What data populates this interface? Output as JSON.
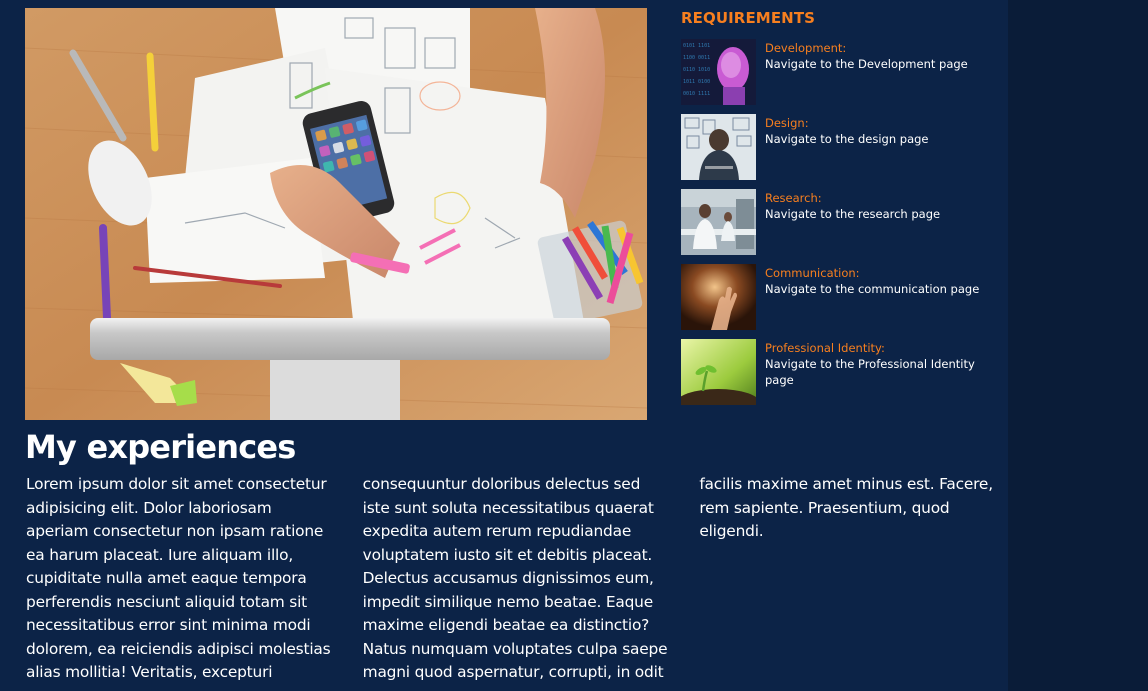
{
  "hero": {
    "image_icon": "desk-workspace-image"
  },
  "requirements": {
    "title": "REQUIREMENTS",
    "items": [
      {
        "label": "Development:",
        "description": "Navigate to the Development page",
        "thumb_icon": "ai-face-image"
      },
      {
        "label": "Design:",
        "description": "Navigate to the design page",
        "thumb_icon": "whiteboard-person-image"
      },
      {
        "label": "Research:",
        "description": "Navigate to the research page",
        "thumb_icon": "laboratory-image"
      },
      {
        "label": "Communication:",
        "description": "Navigate to the communication page",
        "thumb_icon": "hand-light-image"
      },
      {
        "label": "Professional Identity:",
        "description": "Navigate to the Professional Identity page",
        "thumb_icon": "seedling-image"
      }
    ]
  },
  "experiences": {
    "title": "My experiences",
    "body": "Lorem ipsum dolor sit amet consectetur adipisicing elit. Dolor laboriosam aperiam consectetur non ipsam ratione ea harum placeat. Iure aliquam illo, cupiditate nulla amet eaque tempora perferendis nesciunt aliquid totam sit necessitatibus error sint minima modi dolorem, ea reiciendis adipisci molestias alias mollitia! Veritatis, excepturi consequuntur doloribus delectus sed iste sunt soluta necessitatibus quaerat expedita autem rerum repudiandae voluptatem iusto sit et debitis placeat. Delectus accusamus dignissimos eum, impedit similique nemo beatae. Eaque maxime eligendi beatae ea distinctio? Natus numquam voluptates culpa saepe magni quod aspernatur, corrupti, in odit facilis maxime amet minus est. Facere, rem sapiente. Praesentium, quod eligendi."
  },
  "colors": {
    "background": "#0c2347",
    "accent": "#f77f1f",
    "text": "#ffffff"
  }
}
